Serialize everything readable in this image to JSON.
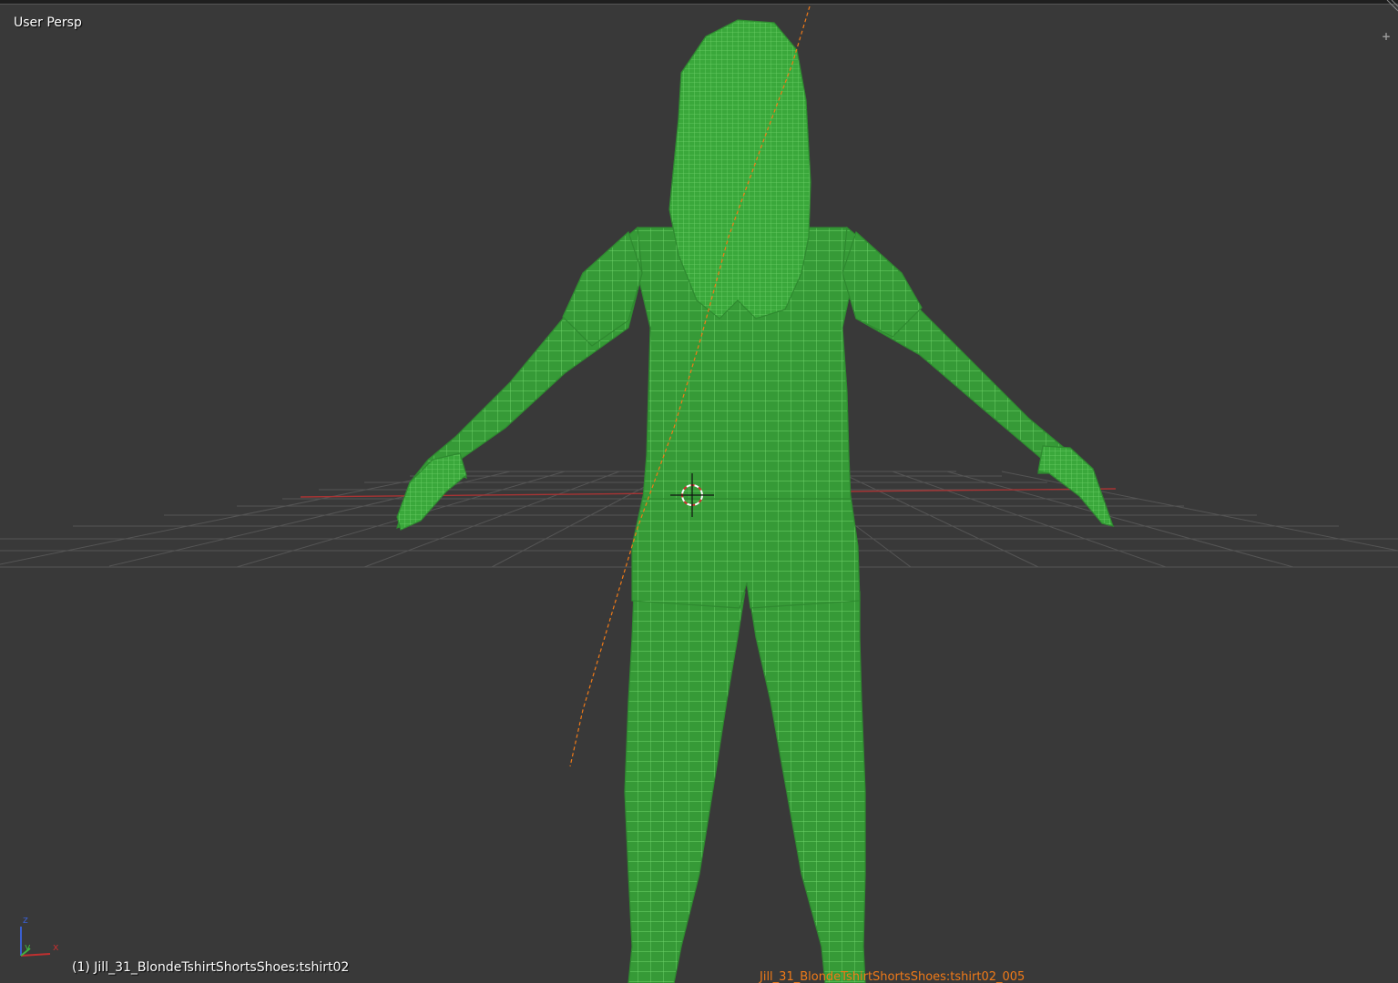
{
  "viewport": {
    "view_name": "User Persp",
    "object_info": "(1) Jill_31_BlondeTshirtShortsShoes:tshirt02",
    "object_label": "Jill_31_BlondeTshirtShortsShoes:tshirt02_005",
    "plus_button": "+",
    "axis_labels": {
      "x": "x",
      "y": "y",
      "z": "z"
    }
  },
  "colors": {
    "background": "#393939",
    "wireframe": "#3fae3f",
    "wireframe_fill": "#39a83a",
    "grid": "#5a5a5a",
    "x_axis": "#a83434",
    "selection": "#f07a18"
  },
  "icons": [
    "3d-cursor-icon",
    "plus-icon",
    "axis-gizmo-icon",
    "corner-drag-icon"
  ]
}
